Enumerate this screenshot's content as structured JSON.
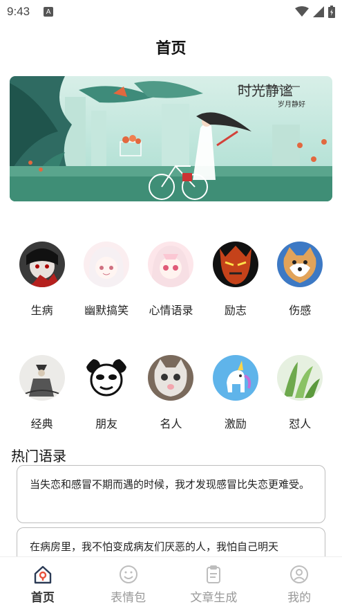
{
  "status": {
    "time": "9:43",
    "notif_icon": "A"
  },
  "header": {
    "title": "首页"
  },
  "banner": {
    "title_art": "时光静谧",
    "subtitle_art": "岁月静好"
  },
  "categories_row1": [
    {
      "label": "生病",
      "icon": "sick-avatar"
    },
    {
      "label": "幽默搞笑",
      "icon": "humor-avatar"
    },
    {
      "label": "心情语录",
      "icon": "mood-avatar"
    },
    {
      "label": "励志",
      "icon": "inspire-avatar"
    },
    {
      "label": "伤感",
      "icon": "sad-avatar"
    }
  ],
  "categories_row2": [
    {
      "label": "经典",
      "icon": "classic-avatar"
    },
    {
      "label": "朋友",
      "icon": "friend-avatar"
    },
    {
      "label": "名人",
      "icon": "celebrity-avatar"
    },
    {
      "label": "激励",
      "icon": "motivate-avatar"
    },
    {
      "label": "怼人",
      "icon": "roast-avatar"
    }
  ],
  "hot": {
    "title": "热门语录",
    "quotes": [
      "当失恋和感冒不期而遇的时候，我才发现感冒比失恋更难受。",
      "在病房里，我不怕变成病友们厌恶的人，我怕自己明天"
    ]
  },
  "tabs": [
    {
      "label": "首页",
      "icon": "home-icon",
      "active": true
    },
    {
      "label": "表情包",
      "icon": "smile-icon",
      "active": false
    },
    {
      "label": "文章生成",
      "icon": "clipboard-icon",
      "active": false
    },
    {
      "label": "我的",
      "icon": "user-icon",
      "active": false
    }
  ],
  "colors": {
    "active": "#e8503a",
    "inactive": "#bdbdbd",
    "teal": "#8fd1c3"
  }
}
